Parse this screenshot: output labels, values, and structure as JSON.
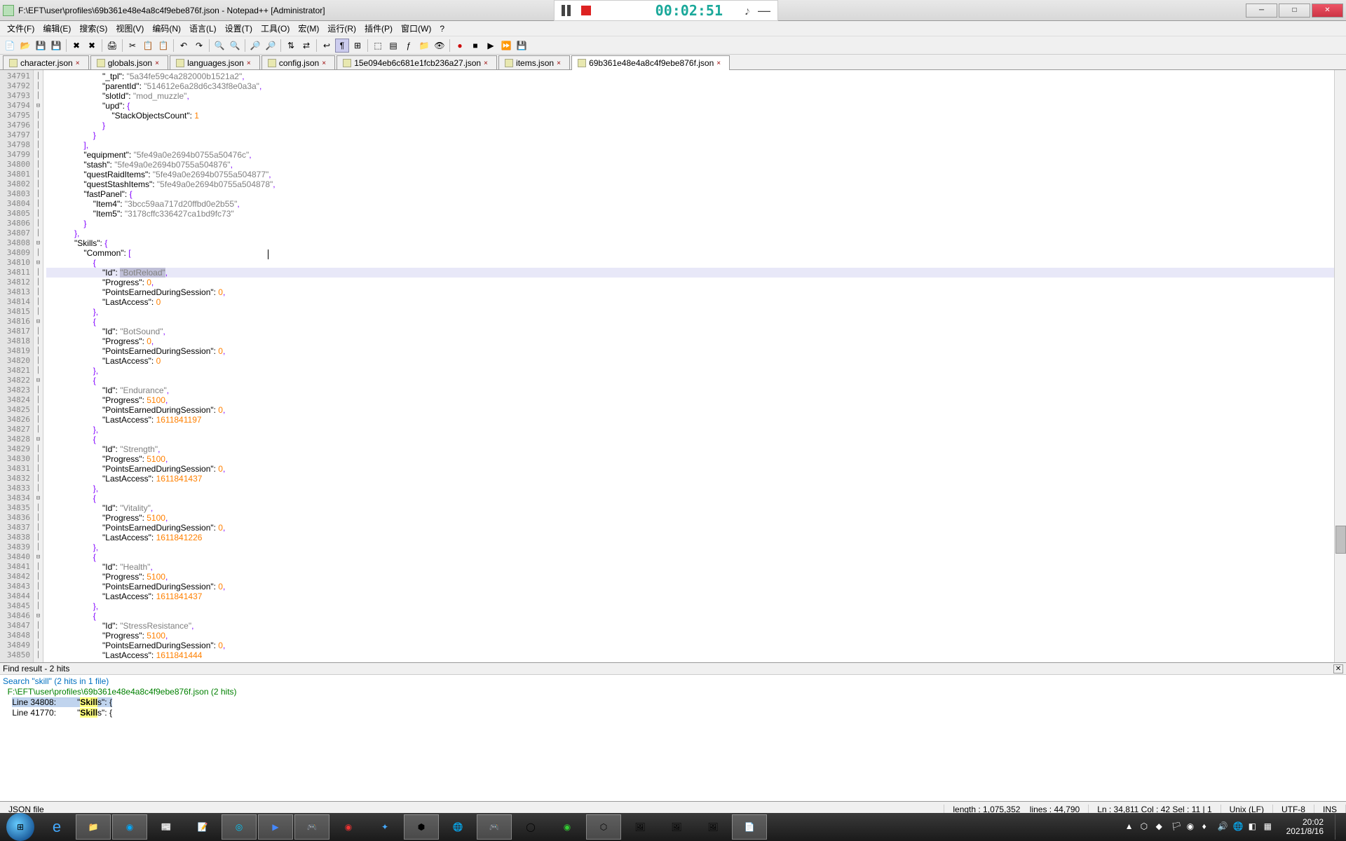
{
  "title": "F:\\EFT\\user\\profiles\\69b361e48e4a8c4f9ebe876f.json - Notepad++ [Administrator]",
  "menu": [
    "文件(F)",
    "编辑(E)",
    "搜索(S)",
    "视图(V)",
    "编码(N)",
    "语言(L)",
    "设置(T)",
    "工具(O)",
    "宏(M)",
    "运行(R)",
    "插件(P)",
    "窗口(W)",
    "?"
  ],
  "tabs": [
    {
      "label": "character.json",
      "active": false
    },
    {
      "label": "globals.json",
      "active": false
    },
    {
      "label": "languages.json",
      "active": false
    },
    {
      "label": "config.json",
      "active": false
    },
    {
      "label": "15e094eb6c681e1fcb236a27.json",
      "active": false
    },
    {
      "label": "items.json",
      "active": false
    },
    {
      "label": "69b361e48e4a8c4f9ebe876f.json",
      "active": true
    }
  ],
  "timer": {
    "time": "00:02:51"
  },
  "gutter_start": 34791,
  "gutter_end": 34850,
  "highlighted_line": 34811,
  "code_lines": [
    "                        \"_tpl\": \"5a34fe59c4a282000b1521a2\",",
    "                        \"parentId\": \"514612e6a28d6c343f8e0a3a\",",
    "                        \"slotId\": \"mod_muzzle\",",
    "                        \"upd\": {",
    "                            \"StackObjectsCount\": 1",
    "                        }",
    "                    }",
    "                ],",
    "                \"equipment\": \"5fe49a0e2694b0755a50476c\",",
    "                \"stash\": \"5fe49a0e2694b0755a504876\",",
    "                \"questRaidItems\": \"5fe49a0e2694b0755a504877\",",
    "                \"questStashItems\": \"5fe49a0e2694b0755a504878\",",
    "                \"fastPanel\": {",
    "                    \"Item4\": \"3bcc59aa717d20ffbd0e2b55\",",
    "                    \"Item5\": \"3178cffc336427ca1bd9fc73\"",
    "                }",
    "            },",
    "            \"Skills\": {",
    "                \"Common\": [",
    "                    {",
    "                        \"Id\": \"BotReload\",",
    "                        \"Progress\": 0,",
    "                        \"PointsEarnedDuringSession\": 0,",
    "                        \"LastAccess\": 0",
    "                    },",
    "                    {",
    "                        \"Id\": \"BotSound\",",
    "                        \"Progress\": 0,",
    "                        \"PointsEarnedDuringSession\": 0,",
    "                        \"LastAccess\": 0",
    "                    },",
    "                    {",
    "                        \"Id\": \"Endurance\",",
    "                        \"Progress\": 5100,",
    "                        \"PointsEarnedDuringSession\": 0,",
    "                        \"LastAccess\": 1611841197",
    "                    },",
    "                    {",
    "                        \"Id\": \"Strength\",",
    "                        \"Progress\": 5100,",
    "                        \"PointsEarnedDuringSession\": 0,",
    "                        \"LastAccess\": 1611841437",
    "                    },",
    "                    {",
    "                        \"Id\": \"Vitality\",",
    "                        \"Progress\": 5100,",
    "                        \"PointsEarnedDuringSession\": 0,",
    "                        \"LastAccess\": 1611841226",
    "                    },",
    "                    {",
    "                        \"Id\": \"Health\",",
    "                        \"Progress\": 5100,",
    "                        \"PointsEarnedDuringSession\": 0,",
    "                        \"LastAccess\": 1611841437",
    "                    },",
    "                    {",
    "                        \"Id\": \"StressResistance\",",
    "                        \"Progress\": 5100,",
    "                        \"PointsEarnedDuringSession\": 0,",
    "                        \"LastAccess\": 1611841444"
  ],
  "find": {
    "header": "Find result - 2 hits",
    "search_line": "Search \"skill\" (2 hits in 1 file)",
    "path_line": "F:\\EFT\\user\\profiles\\69b361e48e4a8c4f9ebe876f.json (2 hits)",
    "results": [
      {
        "line": "Line 34808:",
        "text": "            \"Skills\": {",
        "hl": "Skill"
      },
      {
        "line": "Line 41770:",
        "text": "            \"Skills\": {",
        "hl": "Skill"
      }
    ]
  },
  "status": {
    "type": "JSON file",
    "length": "length : 1,075,352",
    "lines": "lines : 44,790",
    "pos": "Ln : 34,811    Col : 42    Sel : 11 | 1",
    "eol": "Unix (LF)",
    "enc": "UTF-8",
    "ins": "INS"
  },
  "clock": {
    "time": "20:02",
    "date": "2021/8/16"
  }
}
